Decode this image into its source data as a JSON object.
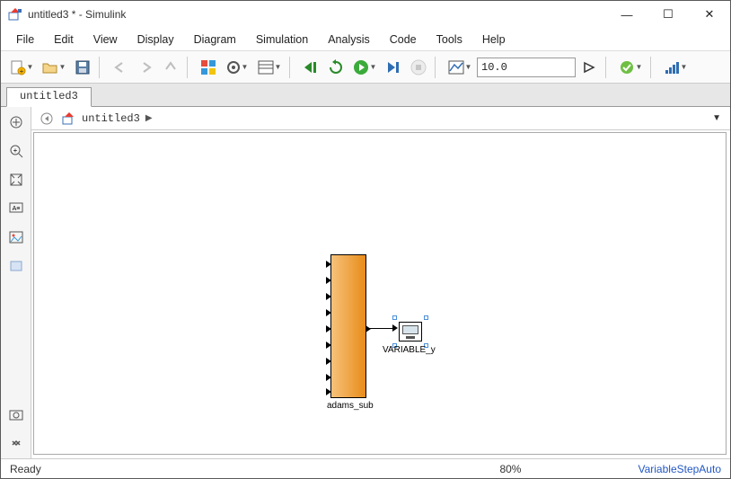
{
  "title": "untitled3 * - Simulink",
  "win": {
    "min": "—",
    "max": "☐",
    "close": "✕"
  },
  "menu": [
    "File",
    "Edit",
    "View",
    "Display",
    "Diagram",
    "Simulation",
    "Analysis",
    "Code",
    "Tools",
    "Help"
  ],
  "toolbar": {
    "sim_time": "10.0"
  },
  "tabs": [
    "untitled3"
  ],
  "breadcrumb": {
    "model": "untitled3",
    "arrow": "▶",
    "drop": "▼"
  },
  "canvas": {
    "block_sub_label": "adams_sub",
    "scope_label": "VARIABLE_y"
  },
  "status": {
    "ready": "Ready",
    "zoom": "80%",
    "solver": "VariableStepAuto"
  }
}
